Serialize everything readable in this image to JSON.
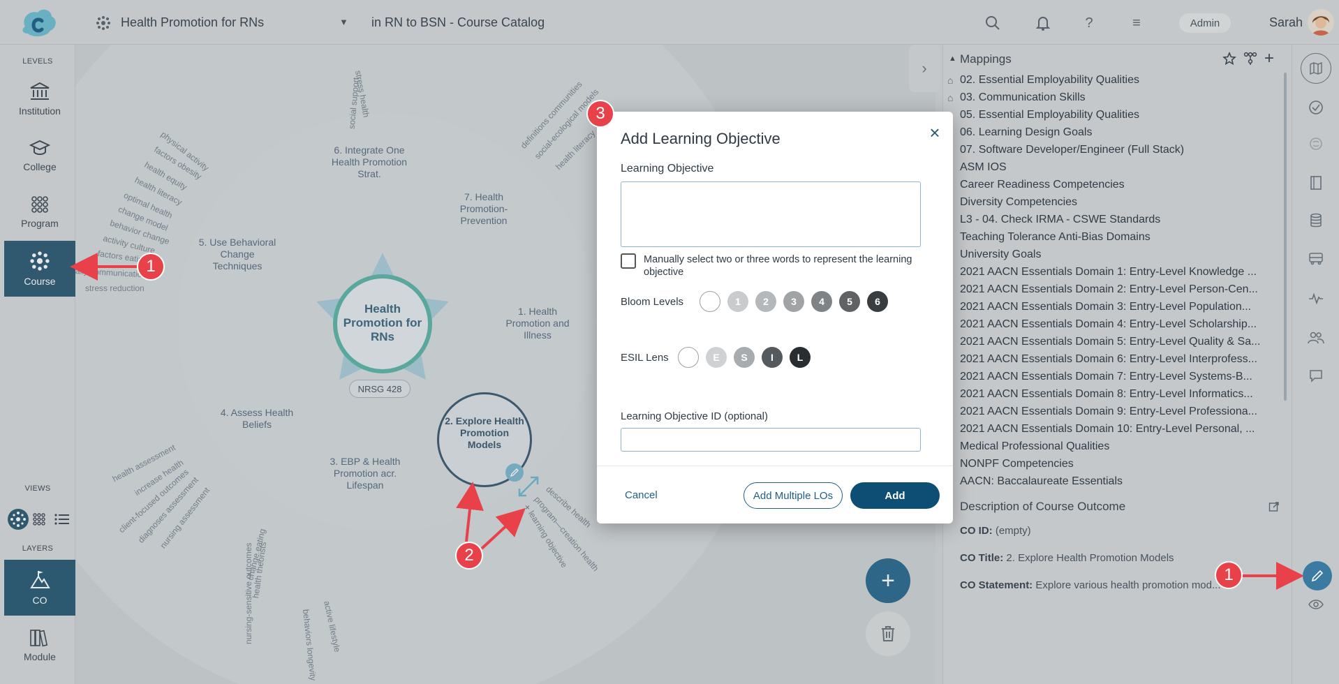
{
  "header": {
    "course_title": "Health Promotion for RNs",
    "catalog": "in RN to BSN - Course Catalog",
    "admin_label": "Admin",
    "user_name": "Sarah"
  },
  "sidebar": {
    "levels_heading": "LEVELS",
    "levels": [
      {
        "label": "Institution",
        "icon": "institution-icon"
      },
      {
        "label": "College",
        "icon": "graduation-cap-icon"
      },
      {
        "label": "Program",
        "icon": "program-dots-icon"
      },
      {
        "label": "Course",
        "icon": "course-gear-icon",
        "active": true
      }
    ],
    "views_heading": "VIEWS",
    "layers_heading": "LAYERS",
    "layers": [
      {
        "label": "CO",
        "icon": "mountain-flag-icon",
        "active": true
      },
      {
        "label": "Module",
        "icon": "books-icon"
      }
    ]
  },
  "mindmap": {
    "center_title": "Health Promotion for RNs",
    "center_code": "NRSG 428",
    "selected_node": "2. Explore Health Promotion Models",
    "nodes": [
      "6. Integrate One Health Promotion Strat.",
      "7. Health Promotion-Prevention",
      "5. Use Behavioral Change Techniques",
      "1. Health Promotion and Illness",
      "4. Assess Health Beliefs",
      "3. EBP & Health Promotion acr. Lifespan"
    ],
    "leaves_top": [
      "stress health",
      "social support"
    ],
    "leaves_node7": [
      "definitions communities",
      "social-ecological models",
      "health literacy"
    ],
    "leaves_node5": [
      "physical activity",
      "factors obesity",
      "health equity",
      "health literacy",
      "optimal health",
      "change model",
      "behavior change",
      "activity culture",
      "factors eating",
      "ally communication",
      "stress reduction"
    ],
    "leaves_node4": [
      "health assessment",
      "increase health",
      "client-focused outcomes",
      "diagnoses assessment",
      "nursing assessment"
    ],
    "leaves_node3": [
      "change eating",
      "health theorists",
      "nursing-sensitive outcomes",
      "behaviors longevity",
      "active lifestyle"
    ],
    "leaves_node2": [
      "describe health",
      "program—creation health",
      "learning objective"
    ]
  },
  "mappings": {
    "title": "Mappings",
    "items": [
      "02. Essential Employability Qualities",
      "03. Communication Skills",
      "05. Essential Employability Qualities",
      "06. Learning Design Goals",
      "07. Software Developer/Engineer (Full Stack)",
      "ASM IOS",
      "Career Readiness Competencies",
      "Diversity Competencies",
      "L3 - 04. Check IRMA - CSWE Standards",
      "Teaching Tolerance Anti-Bias Domains",
      "University Goals",
      "2021 AACN Essentials Domain 1: Entry-Level Knowledge ...",
      "2021 AACN Essentials Domain 2: Entry-Level Person-Cen...",
      "2021 AACN Essentials Domain 3: Entry-Level Population...",
      "2021 AACN Essentials Domain 4: Entry-Level Scholarship...",
      "2021 AACN Essentials Domain 5: Entry-Level Quality & Sa...",
      "2021 AACN Essentials Domain 6: Entry-Level Interprofess...",
      "2021 AACN Essentials Domain 7: Entry-Level Systems-B...",
      "2021 AACN Essentials Domain 8: Entry-Level Informatics...",
      "2021 AACN Essentials Domain 9: Entry-Level Professiona...",
      "2021 AACN Essentials Domain 10: Entry-Level Personal, ...",
      "Medical Professional Qualities",
      "NONPF Competencies",
      "AACN: Baccalaureate Essentials"
    ]
  },
  "description": {
    "title": "Description of Course Outcome",
    "co_id_label": "CO ID:",
    "co_id_value": "(empty)",
    "co_title_label": "CO Title:",
    "co_title_value": "2. Explore Health Promotion Models",
    "co_statement_label": "CO Statement:",
    "co_statement_value": "Explore various health promotion mod..."
  },
  "modal": {
    "title": "Add Learning Objective",
    "lo_label": "Learning Objective",
    "lo_value": "",
    "manual_label": "Manually select two or three words to represent the learning objective",
    "bloom_label": "Bloom Levels",
    "bloom_levels": [
      "",
      "1",
      "2",
      "3",
      "4",
      "5",
      "6"
    ],
    "esil_label": "ESIL Lens",
    "esil_levels": [
      "",
      "E",
      "S",
      "I",
      "L"
    ],
    "lo_id_label": "Learning Objective ID (optional)",
    "lo_id_value": "",
    "cancel_label": "Cancel",
    "multi_label": "Add Multiple LOs",
    "add_label": "Add"
  },
  "callouts": {
    "badge_1": "1",
    "badge_2": "2",
    "badge_3": "3",
    "arrow_color": "#e8414a"
  },
  "colors": {
    "primary": "#0e4d74",
    "active_nav": "#2f5a73",
    "callout": "#e8414a"
  }
}
